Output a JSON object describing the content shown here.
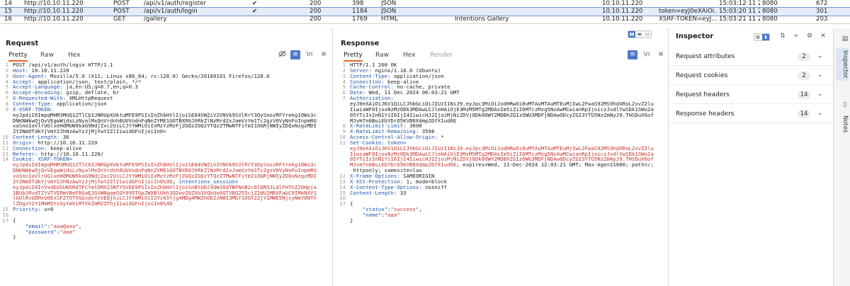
{
  "history": {
    "rows": [
      {
        "num": "14",
        "host": "http://10.10.11.220",
        "method": "POST",
        "url": "/api/v1/auth/register",
        "edited": "✔",
        "status": "200",
        "length": "398",
        "mime": "JSON",
        "title": "",
        "ip": "10.10.11.220",
        "cookies": "",
        "time": "15:03:12 11 2...",
        "port": "8080",
        "id": "672"
      },
      {
        "num": "15",
        "host": "http://10.10.11.220",
        "method": "POST",
        "url": "/api/v1/auth/login",
        "edited": "✔",
        "status": "200",
        "length": "1184",
        "mime": "JSON",
        "title": "",
        "ip": "10.10.11.220",
        "cookies": "token=eyJ0eXAiOi...",
        "time": "15:03:20 11 2...",
        "port": "8080",
        "id": "301"
      },
      {
        "num": "16",
        "host": "http://10.10.11.220",
        "method": "GET",
        "url": "/gallery",
        "edited": "",
        "status": "200",
        "length": "1769",
        "mime": "HTML",
        "title": "Intentions Gallery",
        "ip": "10.10.11.220",
        "cookies": "XSRF-TOKEN=eyJ...",
        "time": "15:03:21 11 2...",
        "port": "8080",
        "id": "203"
      }
    ]
  },
  "request": {
    "title": "Request",
    "tabs": [
      "Pretty",
      "Raw",
      "Hex"
    ],
    "lines": [
      {
        "n": "1",
        "parts": [
          [
            "v",
            "POST /api/v1/auth/login HTTP/1.1"
          ]
        ]
      },
      {
        "n": "2",
        "parts": [
          [
            "k",
            "Host:"
          ],
          [
            "v",
            " 10.10.11.220"
          ]
        ]
      },
      {
        "n": "3",
        "parts": [
          [
            "k",
            "User-Agent:"
          ],
          [
            "v",
            " Mozilla/5.0 (X11; Linux x86_64; rv:128.0) Gecko/20100101 Firefox/128.0"
          ]
        ]
      },
      {
        "n": "4",
        "parts": [
          [
            "k",
            "Accept:"
          ],
          [
            "v",
            " application/json, text/plain, */*"
          ]
        ]
      },
      {
        "n": "5",
        "parts": [
          [
            "k",
            "Accept-Language:"
          ],
          [
            "v",
            " ja,en-US;q=0.7,en;q=0.3"
          ]
        ]
      },
      {
        "n": "6",
        "parts": [
          [
            "k",
            "Accept-Encoding:"
          ],
          [
            "v",
            " gzip, deflate, br"
          ]
        ]
      },
      {
        "n": "7",
        "parts": [
          [
            "k",
            "X-Requested-With:"
          ],
          [
            "v",
            " XMLHttpRequest"
          ]
        ]
      },
      {
        "n": "8",
        "parts": [
          [
            "k",
            "Content-Type:"
          ],
          [
            "v",
            " application/json"
          ]
        ]
      },
      {
        "n": "9",
        "parts": [
          [
            "k",
            "X-XSRF-TOKEN:"
          ]
        ]
      },
      {
        "n": "",
        "parts": [
          [
            "v",
            "eyJpdiI6ImpqMHM3MUQ1ZTlCb3JNRUpXUktuMFE9PSIsInZhbHVlIjoiSE04VWZiV2VNVk9SVlRrY3QySnozRFYrekg1OWs3c"
          ]
        ]
      },
      {
        "n": "",
        "parts": [
          [
            "v",
            "DNKNWkwQjQvVEgwWjdsLzNyalMxQnVrdnh6UUVodnFqNnZYME1GOTBXR0JhRkZlNzMrd2xJamVzYm1Tc2gzV0VyNnFoInpmRU"
          ]
        ]
      },
      {
        "n": "",
        "parts": [
          [
            "v",
            "xaSno1aVlrUGlxeHdMUW9kaG9NdjZxc2UiLCJtYWMiOiIxMzYzMzFjZGQzZGQzYTQzZTMwNTFiYmI1OGRjNWIyZDQxNzgzMDI"
          ]
        ]
      },
      {
        "n": "",
        "parts": [
          [
            "v",
            "2Y2NmOTdkYjVmY2JhNzAwYzJjMjYwY2ZlIiwidGFnIjoiIn0="
          ]
        ]
      },
      {
        "n": "10",
        "parts": [
          [
            "k",
            "Content-Length:"
          ],
          [
            "v",
            " 36"
          ]
        ]
      },
      {
        "n": "11",
        "parts": [
          [
            "k",
            "Origin:"
          ],
          [
            "v",
            " http://10.10.11.220"
          ]
        ]
      },
      {
        "n": "12",
        "parts": [
          [
            "k",
            "Connection:"
          ],
          [
            "v",
            " keep-alive"
          ]
        ]
      },
      {
        "n": "13",
        "parts": [
          [
            "k",
            "Referer:"
          ],
          [
            "v",
            " http://10.10.11.220/"
          ]
        ]
      },
      {
        "n": "14",
        "parts": [
          [
            "k",
            "Cookie:"
          ],
          [
            "b",
            " XSRF-TOKEN="
          ]
        ]
      },
      {
        "n": "",
        "parts": [
          [
            "r",
            "eyJpdiI6ImpqMHM3MUQ1ZTlCb3JNRUpXUktuMFE9PSIsInZhbHVlIjoiSE04VWZiV2VNVk9SVlRrY3QySnozRFYrekg1OWs3c"
          ]
        ]
      },
      {
        "n": "",
        "parts": [
          [
            "r",
            "DNKNWkwQjQvVEgwWjdsLzNyalMxQnVrdnh6UUVodnFqNnZYME1GOTBXR0JhRkZlNzMrd2xJamVzYm1Tc2gzV0VyNnFoInpmRU"
          ]
        ]
      },
      {
        "n": "",
        "parts": [
          [
            "r",
            "xaSno1aVlrUGlxeHdMUW9kaG9NdjZxc2UiLCJtYWMiOiIxMzYzMzFjZGQzZGQzYTQzZTMwNTFiYmI1OGRjNWIyZDQxNzgzMDI"
          ]
        ]
      },
      {
        "n": "",
        "parts": [
          [
            "r",
            "2Y2NmOTdkYjVmY2JhNzAwYzJjMjYwY2ZlIiwidGFnIjoiIn0%3D"
          ],
          [
            "v",
            "; "
          ],
          [
            "b",
            "intentions_session="
          ]
        ]
      },
      {
        "n": "",
        "parts": [
          [
            "r",
            "eyJpdiI6InVsdEdSUW5RdTFCYmtDMXZ3NTY5VEE9PSIsInZhbHVlIjoiSnBtUDJ3OWJ6dTBFNnB2c0lDM3JLdlFHTnZ2OHpja"
          ]
        ]
      },
      {
        "n": "",
        "parts": [
          [
            "r",
            "1BUb1RvdTZtVTVERmVBeFRGaEJGVWNqam5QY095TGpZWXBlUkh3Q2wvZ0ZXb3VQbUo0QTVBQ255cjZ2dU1MRXFaUC9IMkNXV1"
          ]
        ]
      },
      {
        "n": "",
        "parts": [
          [
            "r",
            "lUUlRvUDMxU0ExSFZTOThGUzdvYzVEQjkiLCJtYWMiOiI2Yzk5Yjg4MDg4MWZhODIzNWI3MGY1OGY2ZjY1MWE5NjcyNmY0NTh"
          ]
        ]
      },
      {
        "n": "",
        "parts": [
          [
            "r",
            "lZDgzY2Y1MmM5YzAyYmViMTVkZmM2ZThjIiwidGFnIjoiIn0%3D"
          ]
        ]
      },
      {
        "n": "15",
        "parts": [
          [
            "k",
            "Priority:"
          ],
          [
            "v",
            " u=0"
          ]
        ]
      },
      {
        "n": "16",
        "parts": [
          [
            "v",
            ""
          ]
        ]
      },
      {
        "n": "17",
        "parts": [
          [
            "v",
            "{"
          ]
        ]
      },
      {
        "n": "",
        "parts": [
          [
            "v",
            "    "
          ],
          [
            "b",
            "\"email\""
          ],
          [
            "v",
            ":"
          ],
          [
            "r",
            "\"aaa@aaa\""
          ],
          [
            "v",
            ","
          ]
        ]
      },
      {
        "n": "",
        "parts": [
          [
            "v",
            "    "
          ],
          [
            "b",
            "\"password\""
          ],
          [
            "v",
            ":"
          ],
          [
            "r",
            "\"aaa\""
          ]
        ]
      },
      {
        "n": "",
        "parts": [
          [
            "v",
            "}"
          ]
        ]
      }
    ]
  },
  "response": {
    "title": "Response",
    "tabs": [
      "Pretty",
      "Raw",
      "Hex",
      "Render"
    ],
    "lines": [
      {
        "n": "1",
        "parts": [
          [
            "v",
            "HTTP/1.1 200 OK"
          ]
        ]
      },
      {
        "n": "2",
        "parts": [
          [
            "k",
            "Server:"
          ],
          [
            "v",
            " nginx/1.18.0 (Ubuntu)"
          ]
        ]
      },
      {
        "n": "3",
        "parts": [
          [
            "k",
            "Content-Type:"
          ],
          [
            "v",
            " application/json"
          ]
        ]
      },
      {
        "n": "4",
        "parts": [
          [
            "k",
            "Connection:"
          ],
          [
            "v",
            " keep-alive"
          ]
        ]
      },
      {
        "n": "5",
        "parts": [
          [
            "k",
            "Cache-Control:"
          ],
          [
            "v",
            " no-cache, private"
          ]
        ]
      },
      {
        "n": "6",
        "parts": [
          [
            "k",
            "Date:"
          ],
          [
            "v",
            " Wed, 11 Dec 2024 06:03:21 GMT"
          ]
        ]
      },
      {
        "n": "7",
        "parts": [
          [
            "k",
            "Authorization:"
          ]
        ]
      },
      {
        "n": "",
        "parts": [
          [
            "v",
            "eyJ0eXAiOiJKV1QiLCJhbGciOiJIUzI1NiJ9.eyJpc3MiOiJodHRwOi8vMTAuMTAuMTEuMjIwL2FwaS92MS9hdXRoL2xvZ2lu"
          ]
        ]
      },
      {
        "n": "",
        "parts": [
          [
            "v",
            "IiwiaWF0IjoxNzMzODk3MDAwLCJleHAiOjE3MzM5MTg2MDAsIm5iZiI6MTczMzg5NzAwMCwianRpIjoiczJxdlYwSDk1SWo2a"
          ]
        ]
      },
      {
        "n": "",
        "parts": [
          [
            "v",
            "05YTiIsInN1YiI6IjI4IiwicHJ2IjoiMjNiZDVjODk0OWY2MDBhZGIzOWU3MDFjNDAwODcyZGI3YTU5NzZmNyJ9.THSDuX6of"
          ]
        ]
      },
      {
        "n": "",
        "parts": [
          [
            "v",
            "MJvH7n0BuiEbYDrO5KVB8Xdmp2DfX1ud6E"
          ]
        ]
      },
      {
        "n": "8",
        "parts": [
          [
            "k",
            "X-RateLimit-Limit:"
          ],
          [
            "v",
            " 3600"
          ]
        ]
      },
      {
        "n": "9",
        "parts": [
          [
            "k",
            "X-RateLimit-Remaining:"
          ],
          [
            "v",
            " 3598"
          ]
        ]
      },
      {
        "n": "10",
        "parts": [
          [
            "k",
            "Access-Control-Allow-Origin:"
          ],
          [
            "v",
            " *"
          ]
        ]
      },
      {
        "n": "11",
        "parts": [
          [
            "k",
            "Set-Cookie:"
          ],
          [
            "b",
            " token="
          ]
        ]
      },
      {
        "n": "",
        "parts": [
          [
            "r",
            "eyJ0eXAiOiJKV1QiLCJhbGciOiJIUzI1NiJ9.eyJpc3MiOiJodHRwOi8vMTAuMTAuMTEuMjIwL2FwaS92MS9hdXRoL2xvZ2lu"
          ]
        ]
      },
      {
        "n": "",
        "parts": [
          [
            "r",
            "IiwiaWF0IjoxNzMzODk3MDAwLCJleHAiOjE3MzM5MTg2MDAsIm5iZiI6MTczMzg5NzAwMCwianRpIjoiczJxdlYwSDk1SWo2a"
          ]
        ]
      },
      {
        "n": "",
        "parts": [
          [
            "r",
            "05YTiIsInN1YiI6IjI4IiwicHJ2IjoiMjNiZDVjODk0OWY2MDBhZGIzOWU3MDFjNDAwODcyZGI3YTU5NzZmNyJ9.THSDuX6of"
          ]
        ]
      },
      {
        "n": "",
        "parts": [
          [
            "r",
            "MJvH7n0BuiEbYDrO5KVB8Xdmp2DfX1ud6E"
          ],
          [
            "v",
            "; expires=Wed, 11-Dec-2024 12:03:21 GMT; Max-Age=21600; path=/;"
          ]
        ]
      },
      {
        "n": "",
        "parts": [
          [
            "v",
            " httponly; samesite=lax"
          ]
        ]
      },
      {
        "n": "12",
        "parts": [
          [
            "k",
            "X-Frame-Options:"
          ],
          [
            "v",
            " SAMEORIGIN"
          ]
        ]
      },
      {
        "n": "13",
        "parts": [
          [
            "k",
            "X-XSS-Protection:"
          ],
          [
            "v",
            " 1; mode=block"
          ]
        ]
      },
      {
        "n": "14",
        "parts": [
          [
            "k",
            "X-Content-Type-Options:"
          ],
          [
            "v",
            " nosniff"
          ]
        ]
      },
      {
        "n": "15",
        "parts": [
          [
            "k",
            "Content-Length:"
          ],
          [
            "v",
            " 33"
          ]
        ]
      },
      {
        "n": "16",
        "parts": [
          [
            "v",
            ""
          ]
        ]
      },
      {
        "n": "17",
        "parts": [
          [
            "v",
            "{"
          ]
        ]
      },
      {
        "n": "",
        "parts": [
          [
            "v",
            "    "
          ],
          [
            "b",
            "\"status\""
          ],
          [
            "v",
            ":"
          ],
          [
            "r",
            "\"success\""
          ],
          [
            "v",
            ","
          ]
        ]
      },
      {
        "n": "",
        "parts": [
          [
            "v",
            "    "
          ],
          [
            "b",
            "\"name\""
          ],
          [
            "v",
            ":"
          ],
          [
            "r",
            "\"aaa\""
          ]
        ]
      },
      {
        "n": "",
        "parts": [
          [
            "v",
            "}"
          ]
        ]
      }
    ]
  },
  "inspector": {
    "title": "Inspector",
    "rows": [
      {
        "label": "Request attributes",
        "count": "2"
      },
      {
        "label": "Request cookies",
        "count": "2"
      },
      {
        "label": "Request headers",
        "count": "14"
      },
      {
        "label": "Response headers",
        "count": "14"
      }
    ]
  },
  "side": {
    "tabs": [
      "Inspector",
      "Notes"
    ]
  },
  "icons": {
    "check": "✔",
    "chevron": "⌄"
  },
  "colors": {
    "accent": "#e8681f",
    "blue": "#4c78c9",
    "selected_row": "#e3ecf8",
    "header_name": "#1f55a8",
    "cookie_value": "#c5342a"
  }
}
